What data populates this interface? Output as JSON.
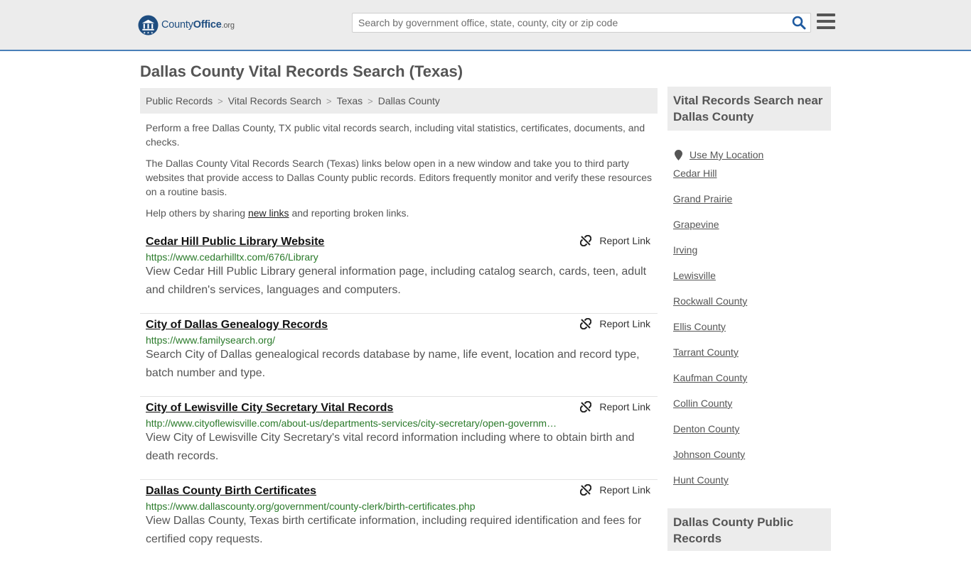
{
  "header": {
    "logo": {
      "part1": "County",
      "part2": "Office",
      "part3": ".org"
    },
    "search_placeholder": "Search by government office, state, county, city or zip code"
  },
  "page_title": "Dallas County Vital Records Search (Texas)",
  "breadcrumb": [
    "Public Records",
    "Vital Records Search",
    "Texas",
    "Dallas County"
  ],
  "intro": {
    "p1": "Perform a free Dallas County, TX public vital records search, including vital statistics, certificates, documents, and checks.",
    "p2": "The Dallas County Vital Records Search (Texas) links below open in a new window and take you to third party websites that provide access to Dallas County public records. Editors frequently monitor and verify these resources on a routine basis.",
    "p3_before": "Help others by sharing ",
    "p3_link": "new links",
    "p3_after": " and reporting broken links."
  },
  "report_label": "Report Link",
  "results": [
    {
      "title": "Cedar Hill Public Library Website",
      "url": "https://www.cedarhilltx.com/676/Library",
      "desc": "View Cedar Hill Public Library general information page, including catalog search, cards, teen, adult and children's services, languages and computers."
    },
    {
      "title": "City of Dallas Genealogy Records",
      "url": "https://www.familysearch.org/",
      "desc": "Search City of Dallas genealogical records database by name, life event, location and record type, batch number and type."
    },
    {
      "title": "City of Lewisville City Secretary Vital Records",
      "url": "http://www.cityoflewisville.com/about-us/departments-services/city-secretary/open-governm…",
      "desc": "View City of Lewisville City Secretary's vital record information including where to obtain birth and death records."
    },
    {
      "title": "Dallas County Birth Certificates",
      "url": "https://www.dallascounty.org/government/county-clerk/birth-certificates.php",
      "desc": "View Dallas County, Texas birth certificate information, including required identification and fees for certified copy requests."
    }
  ],
  "sidebar": {
    "box1_title": "Vital Records Search near Dallas County",
    "use_location": "Use My Location",
    "links": [
      "Cedar Hill",
      "Grand Prairie",
      "Grapevine",
      "Irving",
      "Lewisville",
      "Rockwall County",
      "Ellis County",
      "Tarrant County",
      "Kaufman County",
      "Collin County",
      "Denton County",
      "Johnson County",
      "Hunt County"
    ],
    "box2_title": "Dallas County Public Records"
  },
  "colors": {
    "accent": "#4a80b8",
    "url_green": "#2a7a2a",
    "panel_grey": "#ececec",
    "text": "#555555"
  }
}
